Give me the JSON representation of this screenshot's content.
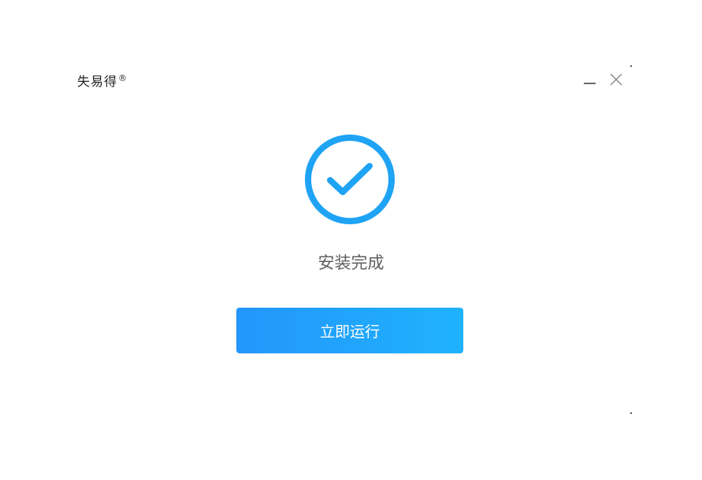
{
  "window": {
    "brand_name": "失易得",
    "brand_mark": "®",
    "controls": {
      "minimize_icon": "minimize-icon",
      "close_icon": "close-icon"
    }
  },
  "main": {
    "status_icon": "check-circle-icon",
    "status_text": "安装完成",
    "run_button_label": "立即运行"
  },
  "colors": {
    "accent": "#1fa3f5",
    "button_gradient_start": "#2396fc",
    "button_gradient_end": "#1fb2fd",
    "status_text": "#5f5f5f"
  }
}
